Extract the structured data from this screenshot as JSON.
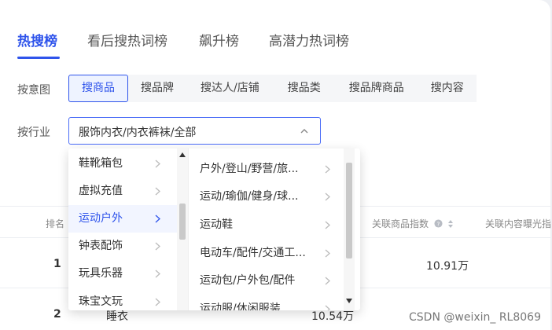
{
  "tabs": [
    {
      "label": "热搜榜",
      "active": true
    },
    {
      "label": "看后搜热词榜",
      "active": false
    },
    {
      "label": "飙升榜",
      "active": false
    },
    {
      "label": "高潜力热词榜",
      "active": false
    }
  ],
  "filters": {
    "intent_label": "按意图",
    "intent_options": [
      "搜商品",
      "搜品牌",
      "搜达人/店铺",
      "搜品类",
      "搜品牌商品",
      "搜内容"
    ],
    "industry_label": "按行业",
    "industry_value": "服饰内衣/内衣裤袜/全部"
  },
  "table": {
    "headers": {
      "rank": "排名",
      "product_index": "关联商品指数",
      "content_exposure": "关联内容曝光指"
    },
    "rows": [
      {
        "rank": "1",
        "keyword": "",
        "search_value": "",
        "product_index": "10.91万"
      },
      {
        "rank": "2",
        "keyword": "睡衣",
        "search_value": "10.54万",
        "product_index": ""
      }
    ]
  },
  "cascader": {
    "level1": [
      "鞋靴箱包",
      "虚拟充值",
      "运动户外",
      "钟表配饰",
      "玩具乐器",
      "珠宝文玩"
    ],
    "level1_selected": "运动户外",
    "level2": [
      "户外/登山/野营/旅...",
      "运动/瑜伽/健身/球...",
      "运动鞋",
      "电动车/配件/交通工...",
      "运动包/户外包/配件",
      "运动服/休闲服装"
    ]
  },
  "watermark": "CSDN @weixin_ RL8069",
  "colors": {
    "accent": "#2f54eb",
    "chip_bg": "#f5f6f8",
    "text": "#333333"
  }
}
